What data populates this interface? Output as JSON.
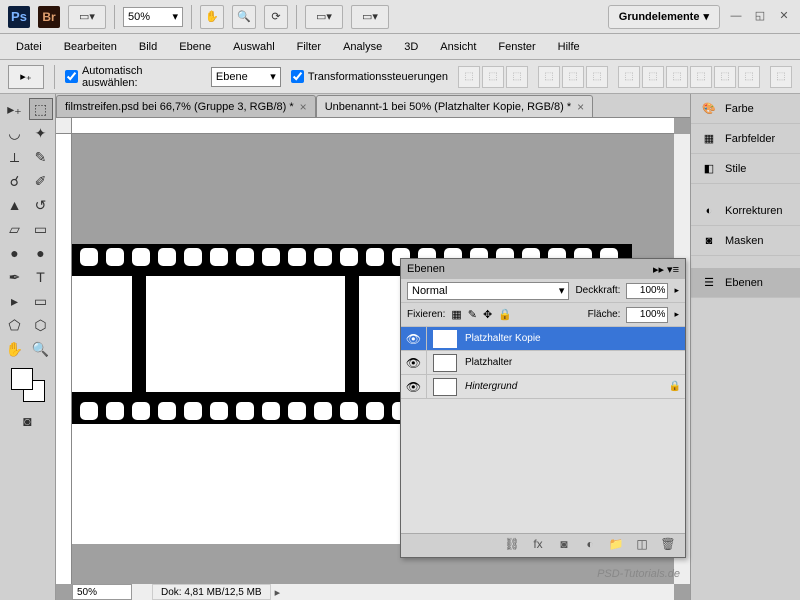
{
  "topbar": {
    "ps": "Ps",
    "br": "Br",
    "zoom": "50%",
    "workspace": "Grundelemente"
  },
  "menu": [
    "Datei",
    "Bearbeiten",
    "Bild",
    "Ebene",
    "Auswahl",
    "Filter",
    "Analyse",
    "3D",
    "Ansicht",
    "Fenster",
    "Hilfe"
  ],
  "options": {
    "auto_select": "Automatisch auswählen:",
    "auto_select_val": "Ebene",
    "transform": "Transformationssteuerungen"
  },
  "tabs": [
    {
      "label": "filmstreifen.psd bei 66,7% (Gruppe 3, RGB/8) *",
      "active": false
    },
    {
      "label": "Unbenannt-1 bei 50% (Platzhalter Kopie, RGB/8) *",
      "active": true
    }
  ],
  "status": {
    "zoom": "50%",
    "doc": "Dok: 4,81 MB/12,5 MB"
  },
  "right_tabs": [
    "Farbe",
    "Farbfelder",
    "Stile",
    "Korrekturen",
    "Masken",
    "Ebenen"
  ],
  "layers_panel": {
    "title": "Ebenen",
    "blend": "Normal",
    "opacity_lbl": "Deckkraft:",
    "opacity_val": "100%",
    "lock_lbl": "Fixieren:",
    "fill_lbl": "Fläche:",
    "fill_val": "100%",
    "layers": [
      {
        "name": "Platzhalter Kopie",
        "selected": true,
        "locked": false,
        "italic": false
      },
      {
        "name": "Platzhalter",
        "selected": false,
        "locked": false,
        "italic": false
      },
      {
        "name": "Hintergrund",
        "selected": false,
        "locked": true,
        "italic": true
      }
    ]
  },
  "watermark": "PSD-Tutorials.de"
}
